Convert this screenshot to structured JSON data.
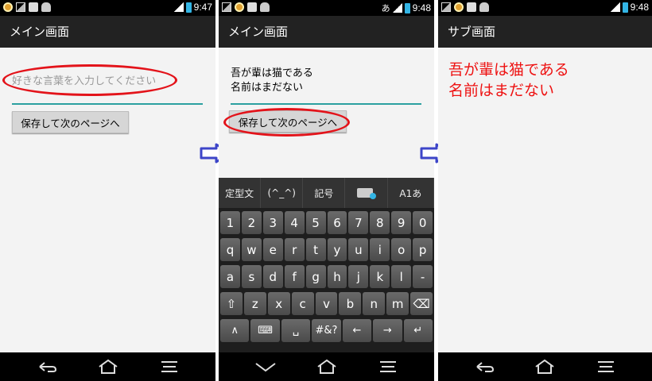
{
  "status": {
    "p1_time": "9:47",
    "p2_time": "9:48",
    "p3_time": "9:48",
    "p2_glyph": "あ",
    "battery_color": "#33b5e5"
  },
  "screen1": {
    "title": "メイン画面",
    "input_placeholder": "好きな言葉を入力してください",
    "button_label": "保存して次のページへ"
  },
  "screen2": {
    "title": "メイン画面",
    "input_line1": "吾が輩は猫である",
    "input_line2": "名前はまだない",
    "button_label": "保存して次のページへ",
    "keyboard": {
      "tabs": [
        "定型文",
        "(^_^)",
        "記号",
        "keyboard-settings-icon",
        "A1あ"
      ],
      "rows": [
        [
          "1",
          "2",
          "3",
          "4",
          "5",
          "6",
          "7",
          "8",
          "9",
          "0"
        ],
        [
          "q",
          "w",
          "e",
          "r",
          "t",
          "y",
          "u",
          "i",
          "o",
          "p"
        ],
        [
          "a",
          "s",
          "d",
          "f",
          "g",
          "h",
          "j",
          "k",
          "l",
          "-"
        ],
        [
          "⇧",
          "z",
          "x",
          "c",
          "v",
          "b",
          "n",
          "m",
          "⌫"
        ],
        [
          "∧",
          "⌨",
          "␣",
          "#&?",
          "←",
          "→",
          "↵"
        ]
      ]
    }
  },
  "screen3": {
    "title": "サブ画面",
    "text": "吾が輩は猫である\n名前はまだない"
  },
  "colors": {
    "highlight": "#e3131a",
    "arrow": "#3d45c8",
    "accent_line": "#2ba0a0"
  }
}
